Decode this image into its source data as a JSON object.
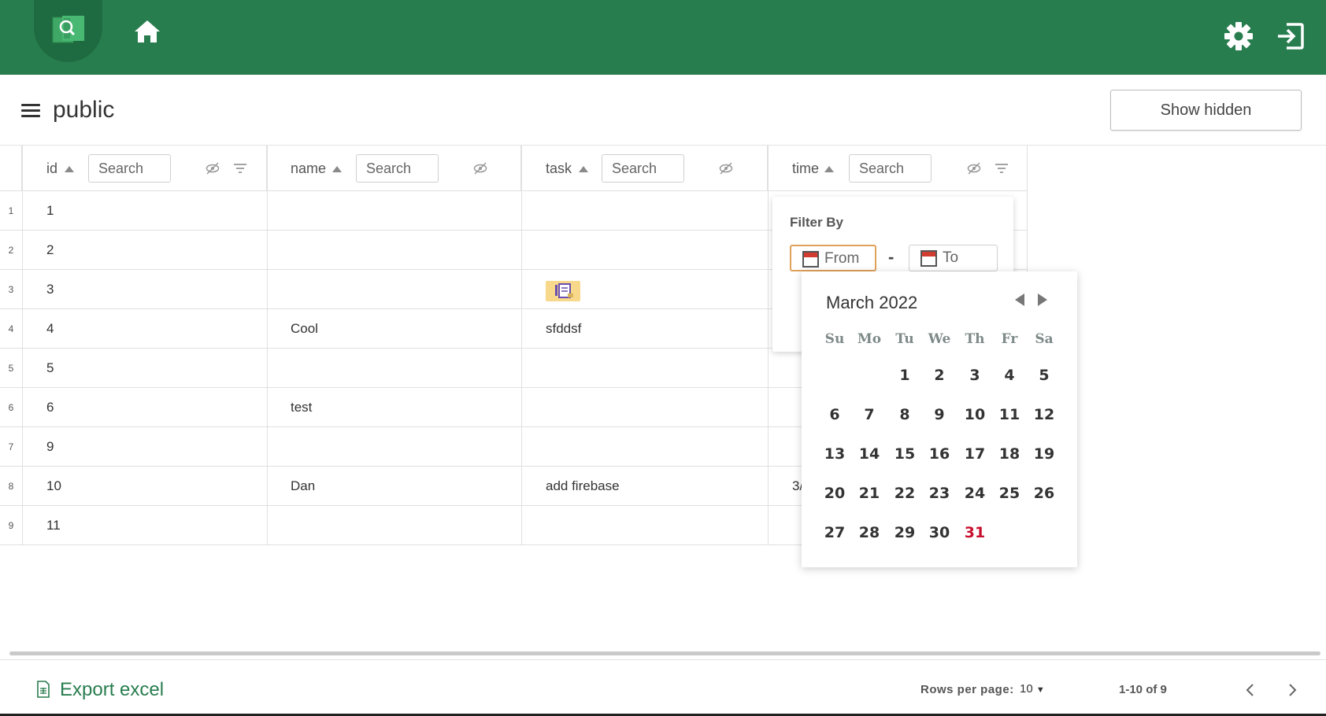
{
  "header": {
    "app_icon": "spreadsheet-search-icon",
    "home_icon": "home-icon",
    "settings_icon": "gear-icon",
    "logout_icon": "exit-icon",
    "brand_color": "#287d4f"
  },
  "title_bar": {
    "title": "public",
    "show_hidden_label": "Show hidden"
  },
  "table": {
    "columns": [
      {
        "key": "id",
        "label": "id",
        "search_placeholder": "Search"
      },
      {
        "key": "name",
        "label": "name",
        "search_placeholder": "Search"
      },
      {
        "key": "task",
        "label": "task",
        "search_placeholder": "Search"
      },
      {
        "key": "time",
        "label": "time",
        "search_placeholder": "Search"
      }
    ],
    "rows": [
      {
        "n": "1",
        "id": "1",
        "name": "",
        "task": "",
        "time": ""
      },
      {
        "n": "2",
        "id": "2",
        "name": "",
        "task": "",
        "time": ""
      },
      {
        "n": "3",
        "id": "3",
        "name": "",
        "task": "",
        "time": ""
      },
      {
        "n": "4",
        "id": "4",
        "name": "Cool",
        "task": "sfddsf",
        "time": ""
      },
      {
        "n": "5",
        "id": "5",
        "name": "",
        "task": "",
        "time": ""
      },
      {
        "n": "6",
        "id": "6",
        "name": "test",
        "task": "",
        "time": ""
      },
      {
        "n": "7",
        "id": "9",
        "name": "",
        "task": "",
        "time": ""
      },
      {
        "n": "8",
        "id": "10",
        "name": "Dan",
        "task": "add firebase",
        "time": "3/"
      },
      {
        "n": "9",
        "id": "11",
        "name": "",
        "task": "",
        "time": ""
      }
    ]
  },
  "filter": {
    "title": "Filter By",
    "from_placeholder": "From",
    "separator": "-",
    "to_placeholder": "To"
  },
  "calendar": {
    "month_label": "March 2022",
    "weekdays": [
      "Su",
      "Mo",
      "Tu",
      "We",
      "Th",
      "Fr",
      "Sa"
    ],
    "weeks": [
      [
        "",
        "",
        "1",
        "2",
        "3",
        "4",
        "5"
      ],
      [
        "6",
        "7",
        "8",
        "9",
        "10",
        "11",
        "12"
      ],
      [
        "13",
        "14",
        "15",
        "16",
        "17",
        "18",
        "19"
      ],
      [
        "20",
        "21",
        "22",
        "23",
        "24",
        "25",
        "26"
      ],
      [
        "27",
        "28",
        "29",
        "30",
        "31",
        "",
        ""
      ]
    ],
    "today": "31",
    "today_color": "#c8102e"
  },
  "footer": {
    "export_label": "Export excel",
    "rows_per_page_label": "Rows per page:",
    "rows_per_page_value": "10",
    "page_range": "1-10 of 9"
  }
}
